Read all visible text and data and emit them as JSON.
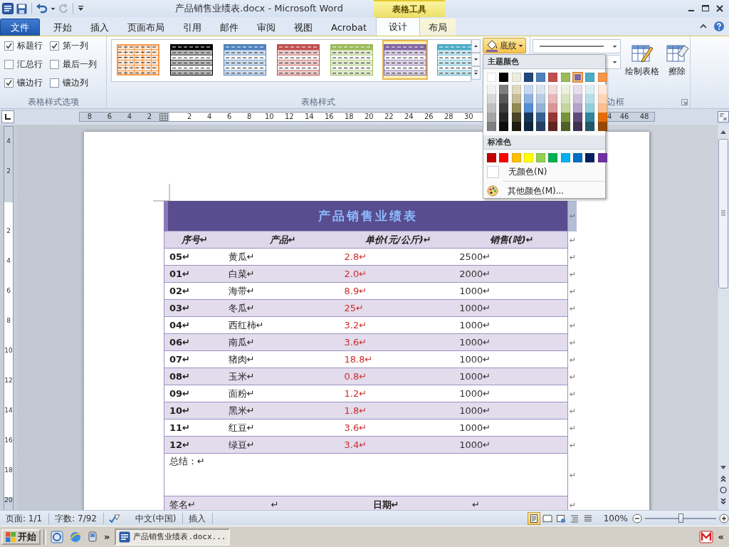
{
  "window": {
    "title": "产品销售业绩表.docx - Microsoft Word",
    "context_group": "表格工具"
  },
  "quick_access": [
    {
      "kind": "app",
      "disabled": false
    },
    {
      "kind": "save",
      "disabled": false
    },
    {
      "kind": "undo",
      "disabled": false
    },
    {
      "kind": "dropdown",
      "disabled": false
    },
    {
      "kind": "redo",
      "disabled": true
    },
    {
      "kind": "customize",
      "disabled": false
    }
  ],
  "tabs": [
    {
      "label": "文件",
      "kind": "file",
      "selected": false
    },
    {
      "label": "开始",
      "kind": "tab",
      "selected": false
    },
    {
      "label": "插入",
      "kind": "tab",
      "selected": false
    },
    {
      "label": "页面布局",
      "kind": "tab",
      "selected": false
    },
    {
      "label": "引用",
      "kind": "tab",
      "selected": false
    },
    {
      "label": "邮件",
      "kind": "tab",
      "selected": false
    },
    {
      "label": "审阅",
      "kind": "tab",
      "selected": false
    },
    {
      "label": "视图",
      "kind": "tab",
      "selected": false
    },
    {
      "label": "Acrobat",
      "kind": "tab",
      "selected": false
    },
    {
      "label": "设计",
      "kind": "context",
      "selected": true
    },
    {
      "label": "布局",
      "kind": "context",
      "selected": false
    }
  ],
  "table_style_options": {
    "label": "表格样式选项",
    "options": [
      {
        "label": "标题行",
        "checked": true
      },
      {
        "label": "第一列",
        "checked": true
      },
      {
        "label": "汇总行",
        "checked": false
      },
      {
        "label": "最后一列",
        "checked": false
      },
      {
        "label": "镶边行",
        "checked": true
      },
      {
        "label": "镶边列",
        "checked": false
      }
    ]
  },
  "table_styles": {
    "label": "表格样式",
    "styles": [
      {
        "kind": "grid",
        "color": "#f79646",
        "selected": false
      },
      {
        "kind": "banded",
        "color": "#000000",
        "selected": false
      },
      {
        "kind": "banded",
        "color": "#4f81bd",
        "selected": false
      },
      {
        "kind": "banded",
        "color": "#c0504d",
        "selected": false
      },
      {
        "kind": "banded",
        "color": "#9bbb59",
        "selected": false
      },
      {
        "kind": "banded",
        "color": "#8064a2",
        "selected": true
      },
      {
        "kind": "banded",
        "color": "#4bacc6",
        "selected": false
      }
    ],
    "shading_button": {
      "label": "底纹",
      "expanded": true
    }
  },
  "borders_group": {
    "label": "边框",
    "draw_table": "绘制表格",
    "eraser": "擦除"
  },
  "shading_menu": {
    "theme_heading": "主题颜色",
    "theme_colors": [
      {
        "color": "#ffffff",
        "selected": false
      },
      {
        "color": "#000000",
        "selected": false
      },
      {
        "color": "#eeece1",
        "selected": false
      },
      {
        "color": "#1f497d",
        "selected": false
      },
      {
        "color": "#4f81bd",
        "selected": false
      },
      {
        "color": "#c0504d",
        "selected": false
      },
      {
        "color": "#9bbb59",
        "selected": false
      },
      {
        "color": "#8064a2",
        "selected": true
      },
      {
        "color": "#4bacc6",
        "selected": false
      },
      {
        "color": "#f79646",
        "selected": false
      }
    ],
    "shades": [
      [
        {
          "color": "#f2f2f2",
          "selected": false
        },
        {
          "color": "#7f7f7f",
          "selected": false
        },
        {
          "color": "#ddd9c3",
          "selected": false
        },
        {
          "color": "#c6d9f0",
          "selected": false
        },
        {
          "color": "#dbe5f1",
          "selected": false
        },
        {
          "color": "#f2dcdb",
          "selected": false
        },
        {
          "color": "#ebf1dd",
          "selected": false
        },
        {
          "color": "#e5e0ec",
          "selected": false
        },
        {
          "color": "#dbeef3",
          "selected": false
        },
        {
          "color": "#fdeada",
          "selected": false
        }
      ],
      [
        {
          "color": "#d8d8d8",
          "selected": false
        },
        {
          "color": "#595959",
          "selected": false
        },
        {
          "color": "#c4bd97",
          "selected": false
        },
        {
          "color": "#8db3e2",
          "selected": false
        },
        {
          "color": "#b8cce4",
          "selected": false
        },
        {
          "color": "#e5b9b7",
          "selected": false
        },
        {
          "color": "#d7e3bc",
          "selected": false
        },
        {
          "color": "#ccc1d9",
          "selected": false
        },
        {
          "color": "#b7dde8",
          "selected": false
        },
        {
          "color": "#fbd5b5",
          "selected": false
        }
      ],
      [
        {
          "color": "#bfbfbf",
          "selected": false
        },
        {
          "color": "#3f3f3f",
          "selected": false
        },
        {
          "color": "#938953",
          "selected": false
        },
        {
          "color": "#548dd4",
          "selected": false
        },
        {
          "color": "#95b3d7",
          "selected": false
        },
        {
          "color": "#d99694",
          "selected": false
        },
        {
          "color": "#c3d69b",
          "selected": false
        },
        {
          "color": "#b2a2c7",
          "selected": false
        },
        {
          "color": "#92cddc",
          "selected": false
        },
        {
          "color": "#fac08f",
          "selected": false
        }
      ],
      [
        {
          "color": "#a5a5a5",
          "selected": false
        },
        {
          "color": "#262626",
          "selected": false
        },
        {
          "color": "#494429",
          "selected": false
        },
        {
          "color": "#17365d",
          "selected": false
        },
        {
          "color": "#366092",
          "selected": false
        },
        {
          "color": "#953734",
          "selected": false
        },
        {
          "color": "#76923c",
          "selected": false
        },
        {
          "color": "#5f497a",
          "selected": false
        },
        {
          "color": "#31859b",
          "selected": false
        },
        {
          "color": "#e36c09",
          "selected": false
        }
      ],
      [
        {
          "color": "#7f7f7f",
          "selected": false
        },
        {
          "color": "#0c0c0c",
          "selected": false
        },
        {
          "color": "#1d1b10",
          "selected": false
        },
        {
          "color": "#0f243e",
          "selected": false
        },
        {
          "color": "#244061",
          "selected": false
        },
        {
          "color": "#632423",
          "selected": false
        },
        {
          "color": "#4f6128",
          "selected": false
        },
        {
          "color": "#3f3151",
          "selected": false
        },
        {
          "color": "#205867",
          "selected": false
        },
        {
          "color": "#974806",
          "selected": false
        }
      ]
    ],
    "standard_heading": "标准色",
    "standard_colors": [
      {
        "color": "#c00000",
        "selected": false
      },
      {
        "color": "#ff0000",
        "selected": false
      },
      {
        "color": "#ffc000",
        "selected": false
      },
      {
        "color": "#ffff00",
        "selected": false
      },
      {
        "color": "#92d050",
        "selected": false
      },
      {
        "color": "#00b050",
        "selected": false
      },
      {
        "color": "#00b0f0",
        "selected": false
      },
      {
        "color": "#0070c0",
        "selected": false
      },
      {
        "color": "#002060",
        "selected": false
      },
      {
        "color": "#7030a0",
        "selected": false
      }
    ],
    "no_color": "无颜色(N)",
    "more_colors": "其他颜色(M)..."
  },
  "ruler": {
    "left_ticks": [
      "8",
      "6",
      "4",
      "2"
    ],
    "right_ticks": [
      "2",
      "4",
      "6",
      "8",
      "10",
      "12",
      "14",
      "16",
      "18",
      "20",
      "22",
      "24",
      "26",
      "28",
      "30"
    ],
    "far_ticks": [
      "4",
      "46",
      "48"
    ]
  },
  "vertical_ruler": {
    "top_ticks": [
      "4",
      "2"
    ],
    "bottom_ticks": [
      "2",
      "4",
      "6",
      "8",
      "10",
      "12",
      "14",
      "16",
      "18",
      "20"
    ]
  },
  "table": {
    "title": "产品销售业绩表",
    "title_end": "↵",
    "columns": [
      "序号↵",
      "产品↵",
      "单价(元/公斤)↵",
      "销售(吨)↵"
    ],
    "header_end": "↵",
    "rows": [
      {
        "no": "05↵",
        "product": "黄瓜↵",
        "price": "2.8↵",
        "sales": "2500↵",
        "end": "↵"
      },
      {
        "no": "01↵",
        "product": "白菜↵",
        "price": "2.0↵",
        "sales": "2000↵",
        "end": "↵"
      },
      {
        "no": "02↵",
        "product": "海带↵",
        "price": "8.9↵",
        "sales": "1000↵",
        "end": "↵"
      },
      {
        "no": "03↵",
        "product": "冬瓜↵",
        "price": "25↵",
        "sales": "1000↵",
        "end": "↵"
      },
      {
        "no": "04↵",
        "product": "西红柿↵",
        "price": "3.2↵",
        "sales": "1000↵",
        "end": "↵"
      },
      {
        "no": "06↵",
        "product": "南瓜↵",
        "price": "3.6↵",
        "sales": "1000↵",
        "end": "↵"
      },
      {
        "no": "07↵",
        "product": "猪肉↵",
        "price": "18.8↵",
        "sales": "1000↵",
        "end": "↵"
      },
      {
        "no": "08↵",
        "product": "玉米↵",
        "price": "0.8↵",
        "sales": "1000↵",
        "end": "↵"
      },
      {
        "no": "09↵",
        "product": "面粉↵",
        "price": "1.2↵",
        "sales": "1000↵",
        "end": "↵"
      },
      {
        "no": "10↵",
        "product": "黑米↵",
        "price": "1.8↵",
        "sales": "1000↵",
        "end": "↵"
      },
      {
        "no": "11↵",
        "product": "红豆↵",
        "price": "3.6↵",
        "sales": "1000↵",
        "end": "↵"
      },
      {
        "no": "12↵",
        "product": "绿豆↵",
        "price": "3.4↵",
        "sales": "1000↵",
        "end": "↵"
      }
    ],
    "summary": {
      "text": "总结：↵",
      "end": "↵"
    },
    "signature": {
      "cells": [
        {
          "text": "签名↵",
          "bold": false
        },
        {
          "text": "↵",
          "bold": false
        },
        {
          "text": "日期↵",
          "bold": true
        },
        {
          "text": "↵",
          "bold": false
        }
      ],
      "end": "↵"
    }
  },
  "status_bar": {
    "page": "页面: 1/1",
    "words": "字数: 7/92",
    "language": "中文(中国)",
    "mode": "插入",
    "views": [
      {
        "selected": true
      },
      {
        "selected": false
      },
      {
        "selected": false
      },
      {
        "selected": false
      },
      {
        "selected": false
      }
    ],
    "zoom": "100%",
    "level": 0.5
  },
  "taskbar": {
    "start": "开始",
    "more": "»",
    "task": {
      "label": "产品销售业绩表.docx...",
      "active": true
    },
    "tray_more": "«"
  }
}
